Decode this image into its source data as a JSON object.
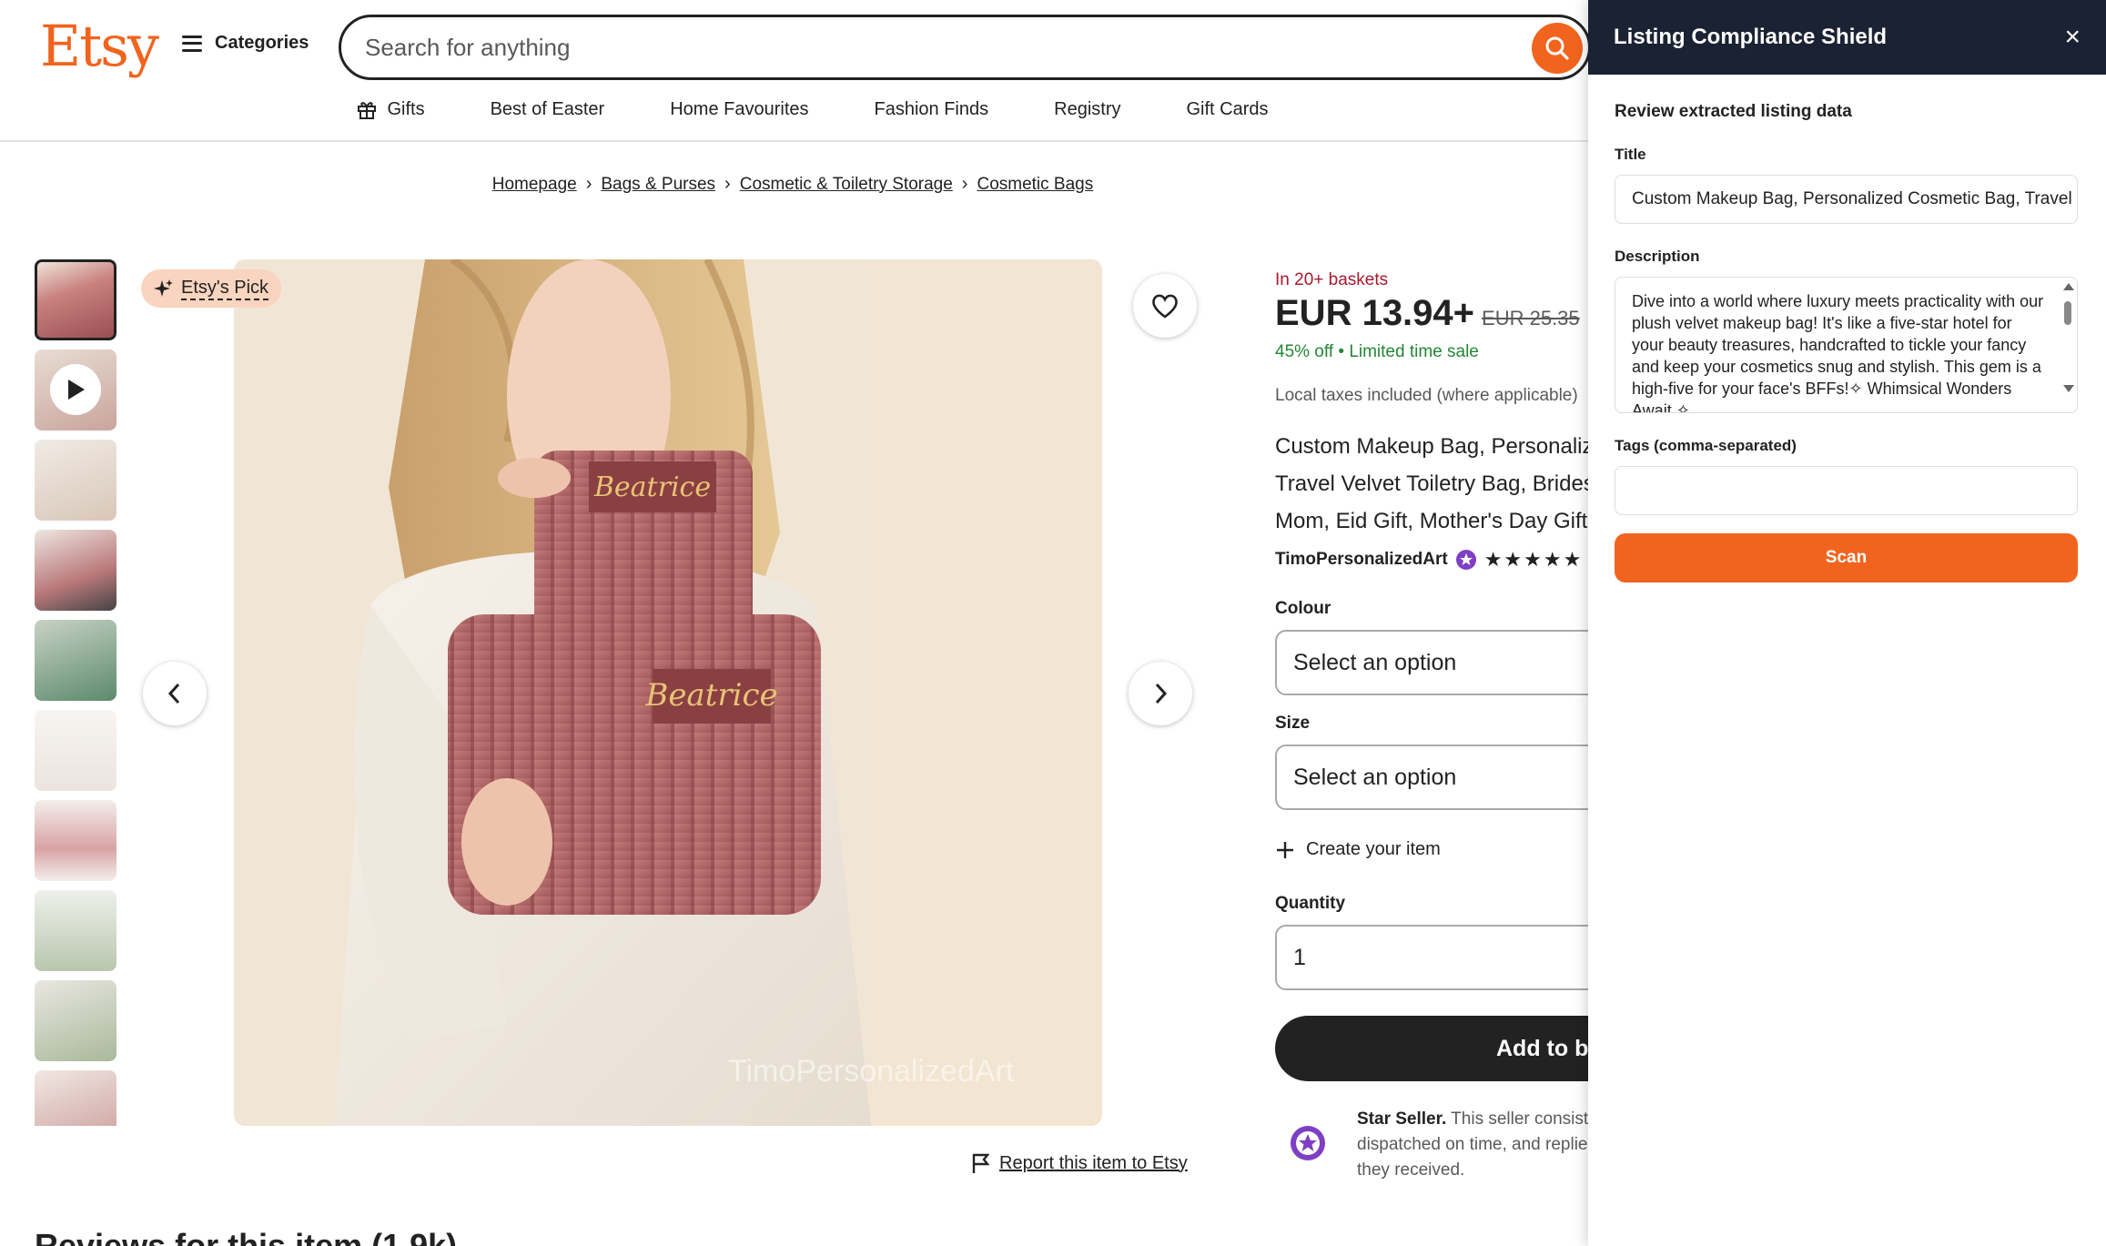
{
  "header": {
    "logo": "Etsy",
    "categories_label": "Categories",
    "search_placeholder": "Search for anything"
  },
  "subnav": [
    {
      "label": "Gifts",
      "icon": "gift-icon"
    },
    {
      "label": "Best of Easter"
    },
    {
      "label": "Home Favourites"
    },
    {
      "label": "Fashion Finds"
    },
    {
      "label": "Registry"
    },
    {
      "label": "Gift Cards"
    }
  ],
  "breadcrumb": [
    "Homepage",
    "Bags & Purses",
    "Cosmetic & Toiletry Storage",
    "Cosmetic Bags"
  ],
  "gallery": {
    "badge": "Etsy's Pick",
    "watermark": "TimoPersonalizedArt",
    "bag_text": "Beatrice",
    "report_label": "Report this item to Etsy"
  },
  "reviews": {
    "heading": "Reviews for this item (1.9k)"
  },
  "product": {
    "baskets": "In 20+ baskets",
    "price": "EUR 13.94+",
    "original_price": "EUR 25.35",
    "discount": "45% off",
    "sale": "Limited time sale",
    "taxes": "Local taxes included (where applicable)",
    "title_lines": [
      "Custom Makeup Bag, Personalized",
      "Travel Velvet Toiletry Bag, Bridesmaid",
      "Mom, Eid Gift, Mother's Day Gift"
    ],
    "shop_name": "TimoPersonalizedArt",
    "rating_stars": "★★★★★",
    "colour_label": "Colour",
    "colour_value": "Select an option",
    "size_label": "Size",
    "size_value": "Select an option",
    "create_label": "Create your item",
    "quantity_label": "Quantity",
    "quantity_value": "1",
    "add_to_basket": "Add to basket",
    "star_seller_title": "Star Seller.",
    "star_seller_lines": [
      "This seller consistently earned",
      "dispatched on time, and replied",
      "they received."
    ]
  },
  "panel": {
    "title": "Listing Compliance Shield",
    "close": "×",
    "subtitle": "Review extracted listing data",
    "title_label": "Title",
    "title_value": "Custom Makeup Bag, Personalized Cosmetic Bag, Travel Velvet Toiletry Bag",
    "description_label": "Description",
    "description_value": "Dive into a world where luxury meets practicality with our plush velvet makeup bag! It's like a five-star hotel for your beauty treasures, handcrafted to tickle your fancy and keep your cosmetics snug and stylish. This gem is a high-five for your face's BFFs!✧ Whimsical Wonders Await ✧",
    "tags_label": "Tags (comma-separated)",
    "tags_value": "",
    "scan_label": "Scan"
  },
  "colors": {
    "brand": "#F1641E",
    "panel_header": "#1A2233",
    "baskets": "#A61A2E",
    "sale": "#258635",
    "star_seller_badge": "#7E3FC4"
  }
}
